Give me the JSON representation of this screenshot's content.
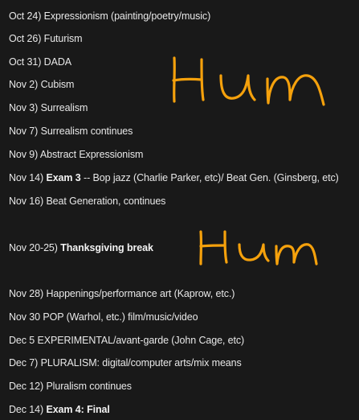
{
  "schedule": [
    {
      "pre": "Oct 24) Expressionism (painting/poetry/music)",
      "bold": "",
      "post": ""
    },
    {
      "pre": "Oct 26) Futurism",
      "bold": "",
      "post": ""
    },
    {
      "pre": "Oct 31) DADA",
      "bold": "",
      "post": ""
    },
    {
      "pre": "Nov 2) Cubism",
      "bold": "",
      "post": ""
    },
    {
      "pre": "Nov 3) Surrealism",
      "bold": "",
      "post": ""
    },
    {
      "pre": "Nov 7) Surrealism continues",
      "bold": "",
      "post": ""
    },
    {
      "pre": "Nov 9) Abstract Expressionism",
      "bold": "",
      "post": ""
    },
    {
      "pre": "Nov 14) ",
      "bold": "Exam 3",
      "post": " -- Bop jazz (Charlie Parker, etc)/ Beat Gen. (Ginsberg, etc)"
    },
    {
      "pre": "Nov 16) Beat Generation, continues",
      "bold": "",
      "post": ""
    },
    {
      "pre": "Nov 20-25) ",
      "bold": "Thanksgiving break",
      "post": ""
    },
    {
      "pre": "Nov 28) Happenings/performance art (Kaprow, etc.)",
      "bold": "",
      "post": ""
    },
    {
      "pre": "Nov 30 POP (Warhol, etc.) film/music/video",
      "bold": "",
      "post": ""
    },
    {
      "pre": "Dec 5 EXPERIMENTAL/avant-garde (John Cage, etc)",
      "bold": "",
      "post": ""
    },
    {
      "pre": "Dec 7) PLURALISM: digital/computer arts/mix means",
      "bold": "",
      "post": ""
    },
    {
      "pre": "Dec 12) Pluralism continues",
      "bold": "",
      "post": ""
    },
    {
      "pre": "Dec 14) ",
      "bold": "Exam 4: Final",
      "post": ""
    }
  ],
  "annotations": {
    "first": "Hum",
    "second": "Hum",
    "color": "#f5a10c"
  },
  "colors": {
    "background": "#191919",
    "text": "#e8e8e8"
  }
}
